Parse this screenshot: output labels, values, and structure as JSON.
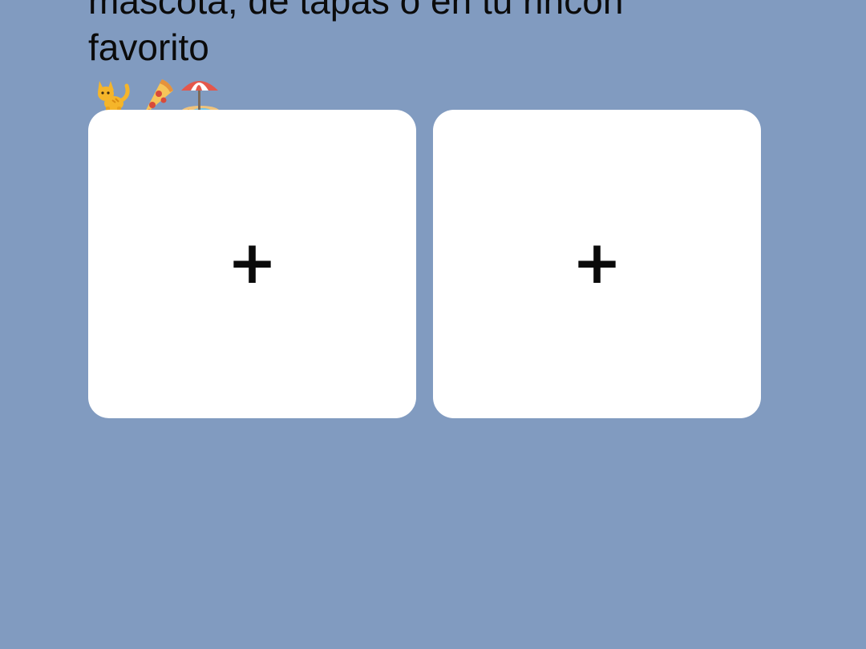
{
  "headline": {
    "line1": "mascota, de tapas o en tu rincón",
    "line2": "favorito"
  },
  "emojis": [
    "cat-emoji-icon",
    "pizza-emoji-icon",
    "beach-umbrella-emoji-icon"
  ],
  "tiles": [
    {
      "icon": "plus-icon",
      "label": "+"
    },
    {
      "icon": "plus-icon",
      "label": "+"
    }
  ],
  "colors": {
    "background": "#819BC0",
    "tile": "#FFFFFF",
    "text": "#0B0B0B"
  }
}
